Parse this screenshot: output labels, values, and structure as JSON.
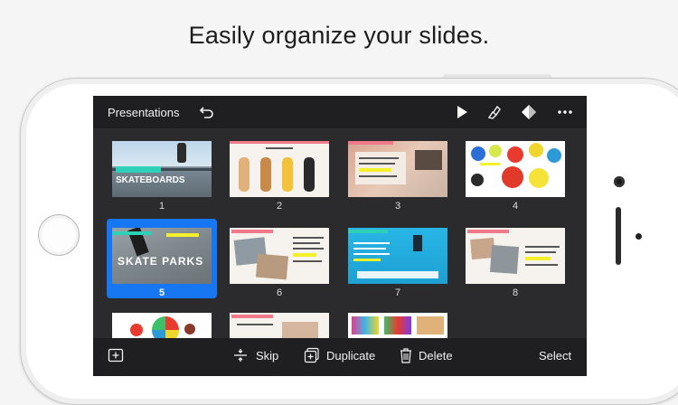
{
  "headline": "Easily organize your slides.",
  "toolbar": {
    "title": "Presentations",
    "icons": [
      "undo-icon",
      "play-icon",
      "brush-icon",
      "diamond-icon",
      "more-icon"
    ]
  },
  "slides": [
    {
      "number": "1"
    },
    {
      "number": "2"
    },
    {
      "number": "3"
    },
    {
      "number": "4"
    },
    {
      "number": "5",
      "selected": true
    },
    {
      "number": "6"
    },
    {
      "number": "7"
    },
    {
      "number": "8"
    }
  ],
  "thumb_text": {
    "s1": "SKATEBOARDS",
    "s5": "SKATE PARKS"
  },
  "bottom_bar": {
    "skip": "Skip",
    "duplicate": "Duplicate",
    "delete": "Delete",
    "select": "Select"
  },
  "colors": {
    "accent": "#1777f2",
    "toolbar_bg": "#1f1f21",
    "screen_bg": "#2b2b2d",
    "highlight": "#f4f12a"
  }
}
